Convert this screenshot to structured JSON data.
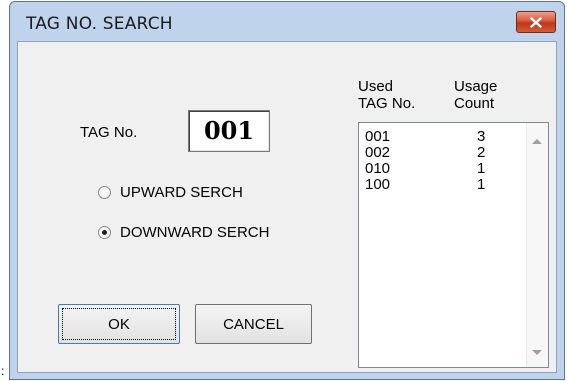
{
  "stray_char": ":",
  "window": {
    "title": "TAG NO. SEARCH",
    "close_icon": "close-icon"
  },
  "form": {
    "tag_label": "TAG No.",
    "tag_value": "001",
    "radio_upward": {
      "label": "UPWARD SERCH",
      "checked": false
    },
    "radio_downward": {
      "label": "DOWNWARD SERCH",
      "checked": true
    }
  },
  "buttons": {
    "ok": "OK",
    "cancel": "CANCEL"
  },
  "list": {
    "col1_header_line1": "Used",
    "col1_header_line2": "TAG No.",
    "col2_header_line1": "Usage",
    "col2_header_line2": "Count",
    "rows": [
      {
        "tag": "001",
        "count": "3"
      },
      {
        "tag": "002",
        "count": "2"
      },
      {
        "tag": "010",
        "count": "1"
      },
      {
        "tag": "100",
        "count": "1"
      }
    ]
  },
  "colors": {
    "window_frame": "#bfd3ec",
    "client_bg": "#f0f0f0",
    "close_button": "#c7452a"
  }
}
